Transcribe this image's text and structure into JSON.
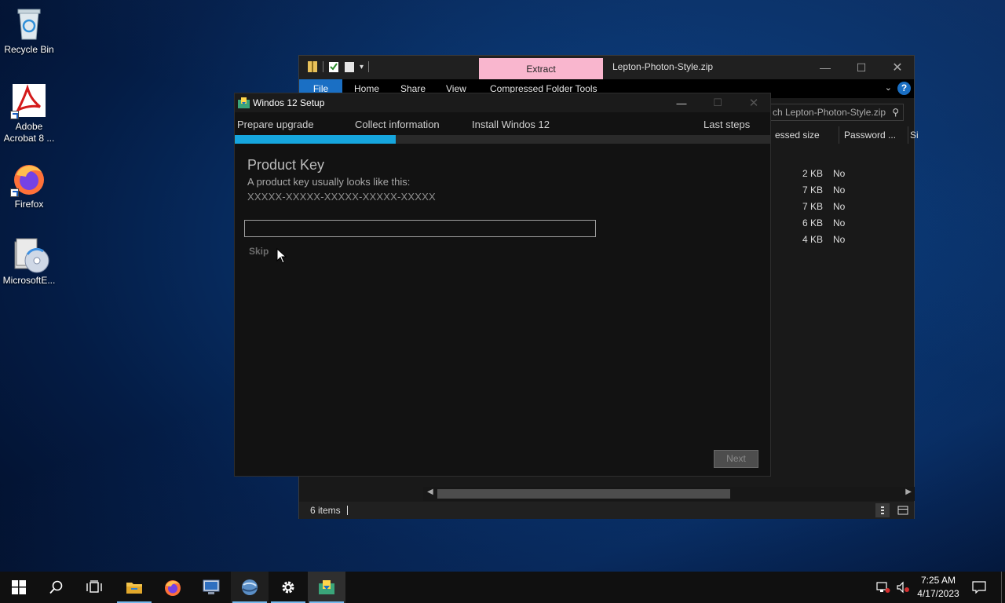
{
  "desktop": {
    "icons": [
      {
        "label": "Recycle Bin"
      },
      {
        "label": "Adobe\nAcrobat 8 ..."
      },
      {
        "label": "Firefox"
      },
      {
        "label": "MicrosoftE..."
      }
    ]
  },
  "explorer": {
    "contextual_tab": "Extract",
    "title": "Lepton-Photon-Style.zip",
    "ribbon_tabs": {
      "file": "File",
      "home": "Home",
      "share": "Share",
      "view": "View",
      "tools": "Compressed Folder Tools"
    },
    "search_placeholder": "ch Lepton-Photon-Style.zip",
    "columns": {
      "compressed": "essed size",
      "password": "Password ...",
      "size": "Si"
    },
    "rows": [
      {
        "size": "2 KB",
        "password": "No"
      },
      {
        "size": "7 KB",
        "password": "No"
      },
      {
        "size": "7 KB",
        "password": "No"
      },
      {
        "size": "6 KB",
        "password": "No"
      },
      {
        "size": "4 KB",
        "password": "No"
      }
    ],
    "status": {
      "items": "6 items"
    },
    "accent": "#1a6fc4",
    "extract_color": "#f9b6ce"
  },
  "setup": {
    "title": "Windos 12 Setup",
    "steps": {
      "prepare": "Prepare upgrade",
      "collect": "Collect information",
      "install": "Install Windos 12",
      "last": "Last steps"
    },
    "progress": 0.3,
    "heading": "Product Key",
    "description": "A product key usually looks like this:",
    "sample_key": "XXXXX-XXXXX-XXXXX-XXXXX-XXXXX",
    "input_value": "",
    "skip_label": "Skip",
    "next_label": "Next",
    "progress_color": "#16a6de"
  },
  "taskbar": {
    "time": "7:25 AM",
    "date": "4/17/2023"
  }
}
